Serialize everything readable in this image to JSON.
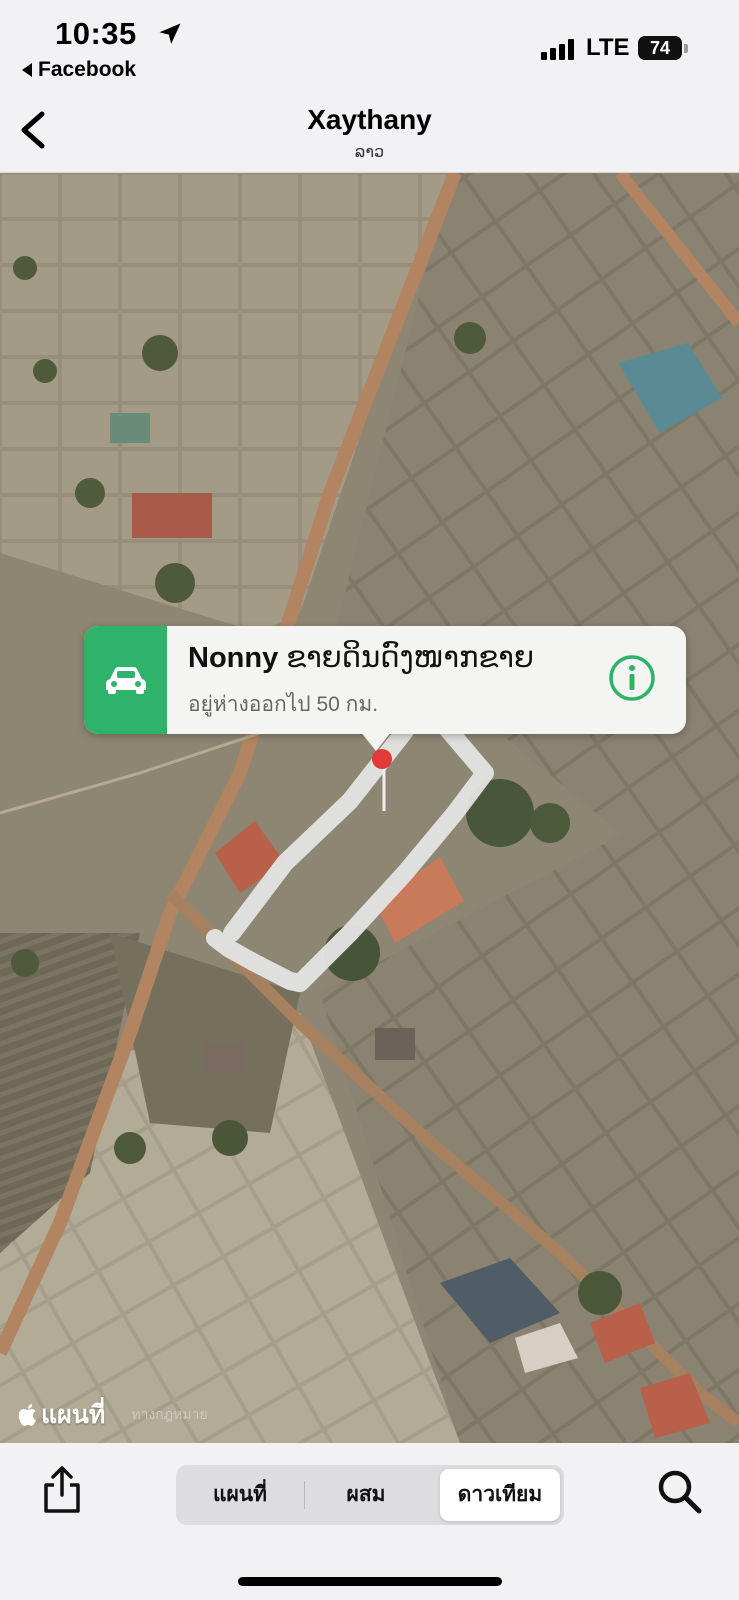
{
  "status_bar": {
    "time": "10:35",
    "back_app": "Facebook",
    "network": "LTE",
    "battery": "74"
  },
  "nav": {
    "title": "Xaythany",
    "subtitle": "ລາວ"
  },
  "callout": {
    "title_bold": "Nonny",
    "title_rest": " ຂາຍດິນດົງໜາກຂາຍ",
    "subtitle": "อยู่ห่างออกไป 50 กม.",
    "icon": "car-icon",
    "info_icon": "info-icon"
  },
  "map_footer": {
    "brand": "แผนที่",
    "legal": "ทางกฎหมาย"
  },
  "toolbar": {
    "segments": [
      "แผนที่",
      "ผสม",
      "ดาวเทียม"
    ],
    "selected": "ดาวเทียม"
  },
  "colors": {
    "accent_green": "#2fb36b",
    "background": "#f2f2f4"
  }
}
